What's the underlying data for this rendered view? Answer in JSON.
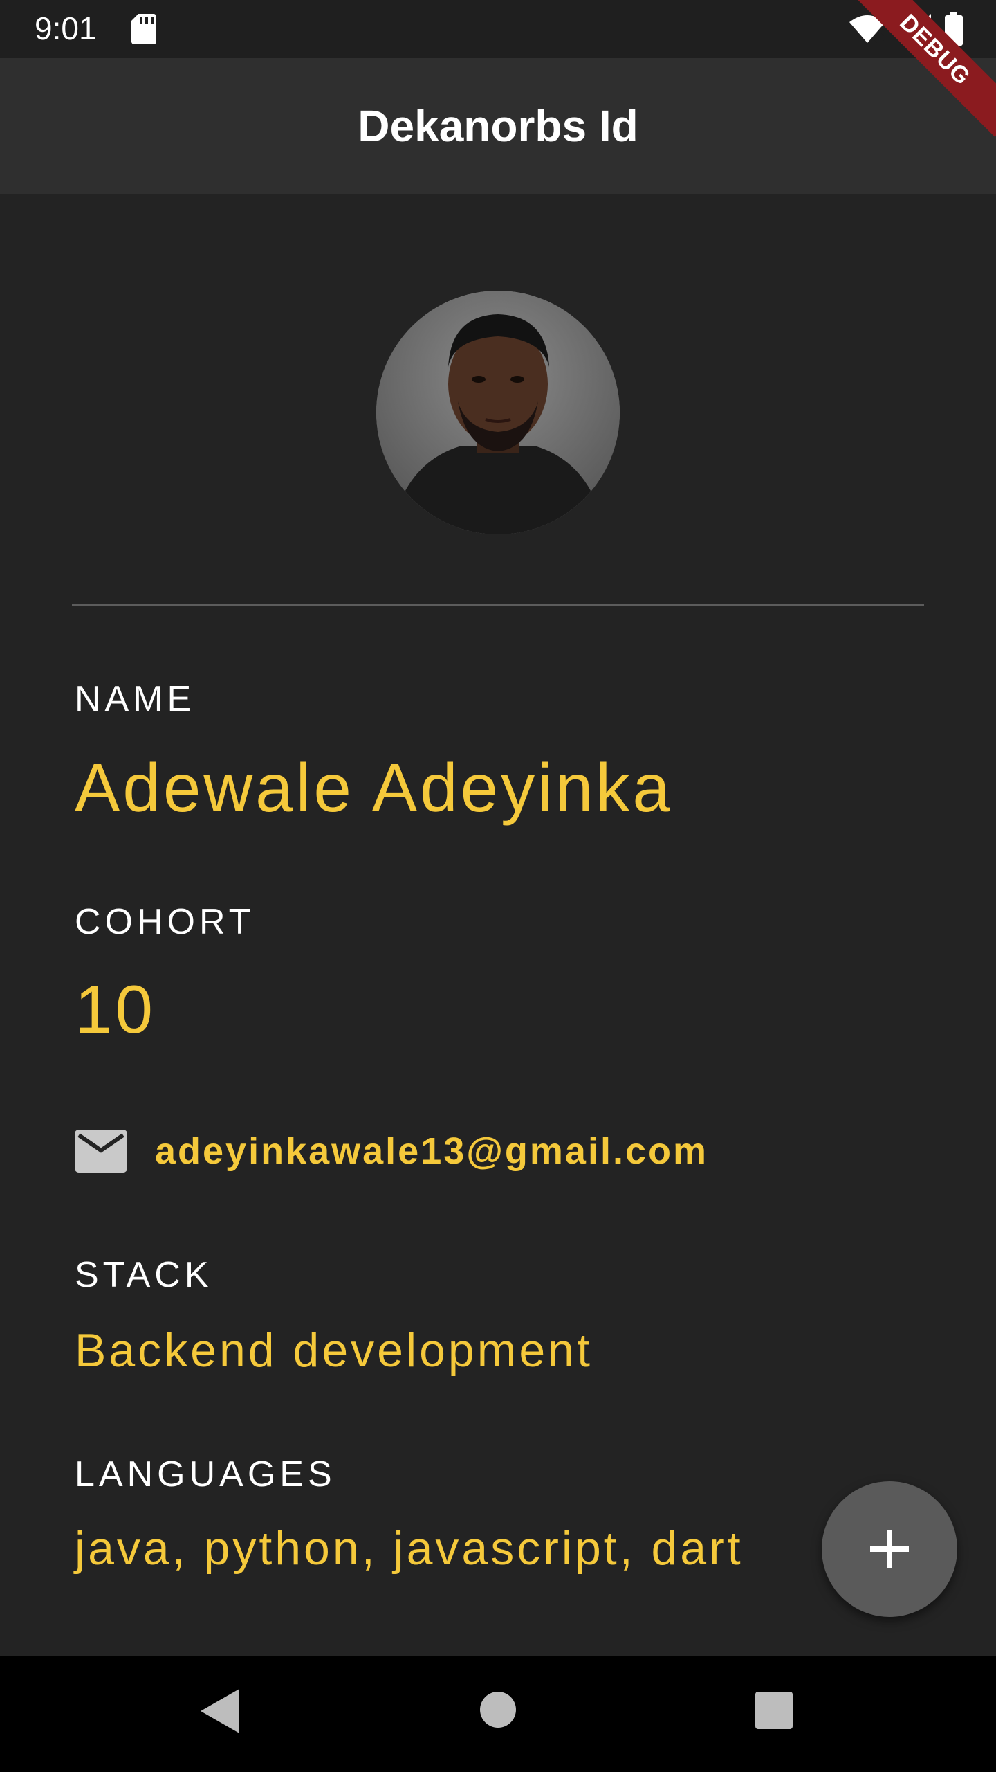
{
  "status_bar": {
    "time": "9:01",
    "icons": [
      "sd-card-icon",
      "wifi-icon",
      "signal-icon",
      "battery-icon"
    ]
  },
  "debug_banner": "DEBUG",
  "app_bar": {
    "title": "Dekanorbs Id"
  },
  "profile": {
    "avatar_alt": "profile-photo",
    "name_label": "NAME",
    "name_value": "Adewale Adeyinka",
    "cohort_label": "COHORT",
    "cohort_value": "10",
    "email": "adeyinkawale13@gmail.com",
    "stack_label": "STACK",
    "stack_value": "Backend development",
    "languages_label": "LANGUAGES",
    "languages_value": "java, python, javascript, dart"
  },
  "fab": {
    "icon": "plus-icon"
  },
  "nav_bar": {
    "icons": [
      "back-icon",
      "home-icon",
      "recents-icon"
    ]
  },
  "colors": {
    "accent": "#f5c93b",
    "background": "#232323",
    "app_bar": "#2f2f2f",
    "debug": "#8b1b1f"
  }
}
